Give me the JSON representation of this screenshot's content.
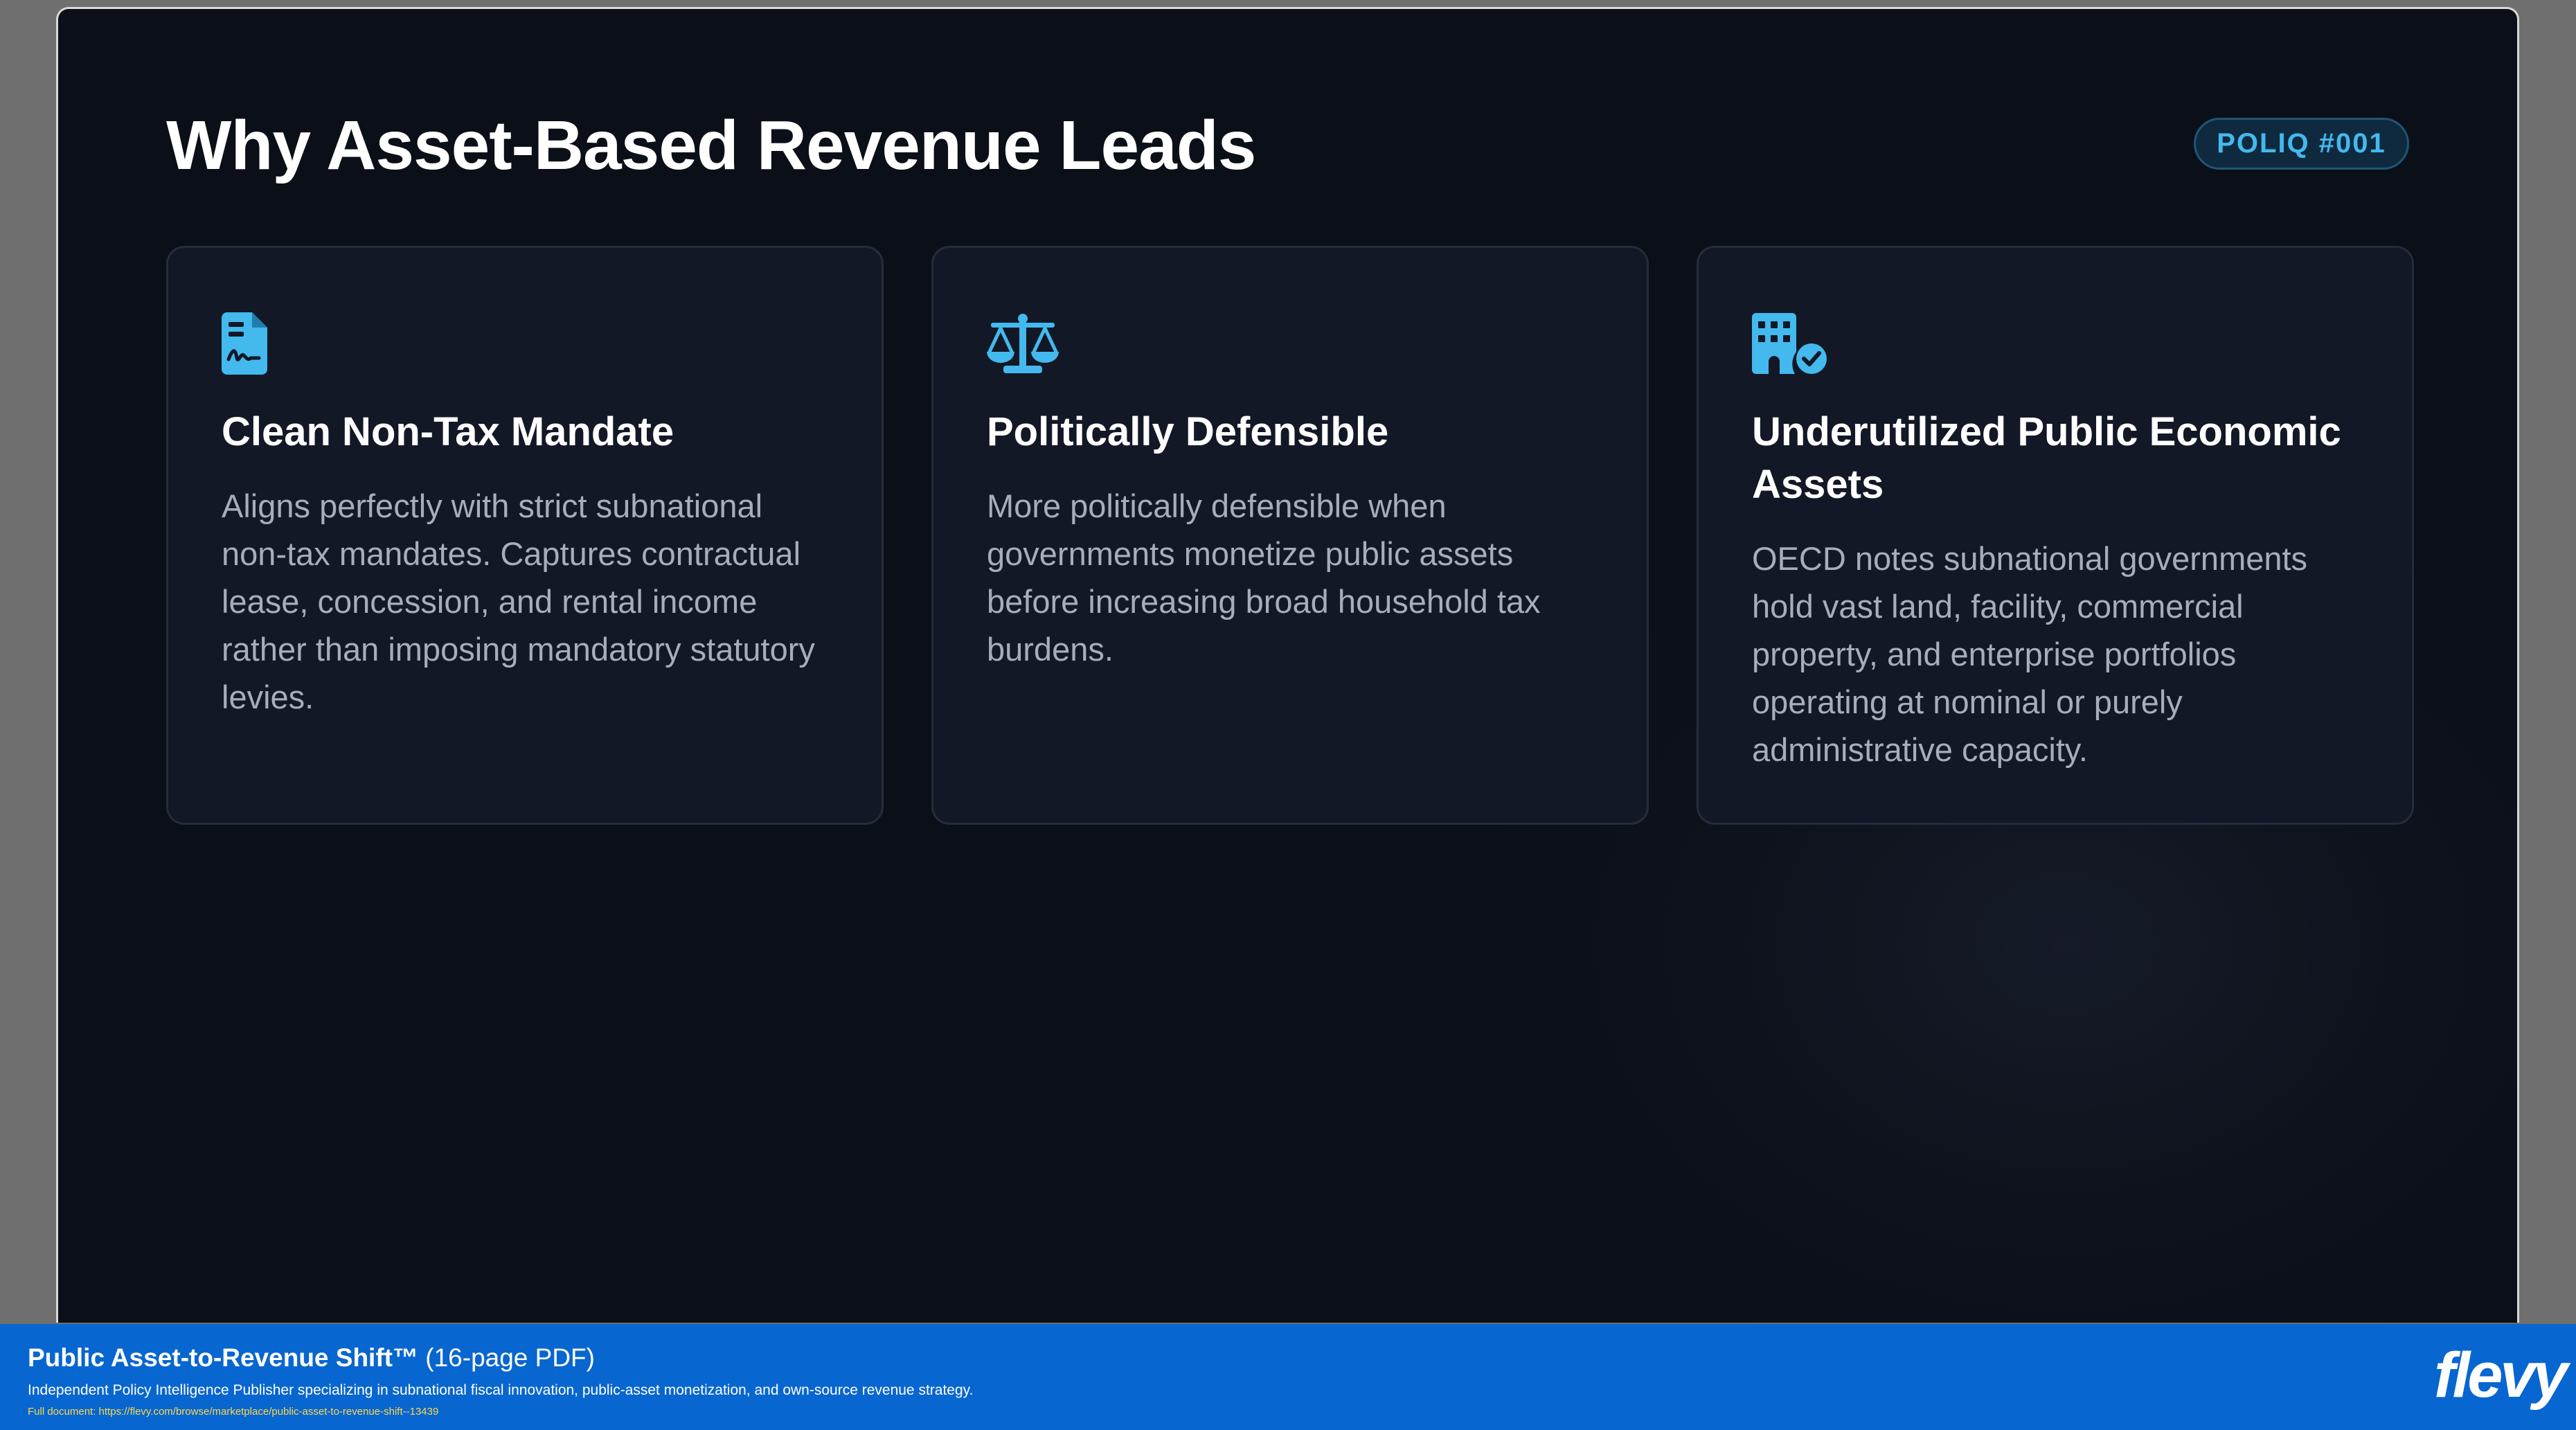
{
  "slide": {
    "title": "Why Asset-Based Revenue Leads",
    "badge": "POLIQ #001",
    "accent_color": "#43b9ee",
    "cards": [
      {
        "icon": "document-signature-icon",
        "heading": "Clean Non-Tax Mandate",
        "body": "Aligns perfectly with strict subnational non-tax mandates. Captures contractual lease, concession, and rental income rather than imposing mandatory statutory levies."
      },
      {
        "icon": "balance-scale-icon",
        "heading": "Politically Defensible",
        "body": "More politically defensible when governments monetize public assets before increasing broad household tax burdens."
      },
      {
        "icon": "building-check-icon",
        "heading": "Underutilized Public Economic Assets",
        "body": "OECD notes subnational governments hold vast land, facility, commercial property, and enterprise portfolios operating at nominal or purely administrative capacity."
      }
    ]
  },
  "footer": {
    "title": "Public Asset-to-Revenue Shift™",
    "title_suffix": "(16-page PDF)",
    "description": "Independent Policy Intelligence Publisher specializing in subnational fiscal innovation, public-asset monetization, and own-source revenue strategy.",
    "url": "Full document: https://flevy.com/browse/marketplace/public-asset-to-revenue-shift--13439",
    "logo": "flevy",
    "background_color": "#0866d0"
  }
}
